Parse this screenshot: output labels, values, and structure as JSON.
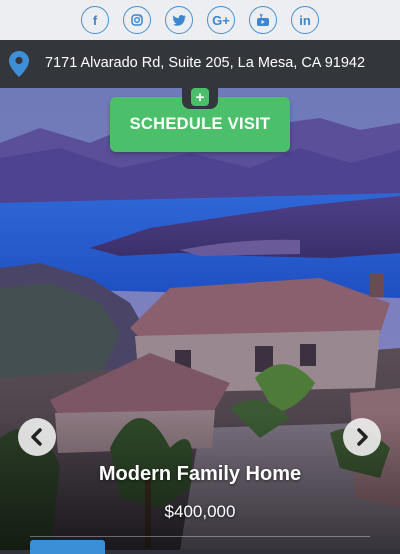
{
  "social": {
    "items": [
      {
        "name": "facebook-icon",
        "glyph": "f"
      },
      {
        "name": "instagram-icon",
        "glyph": ""
      },
      {
        "name": "twitter-icon",
        "glyph": ""
      },
      {
        "name": "google-plus-icon",
        "glyph": "G+"
      },
      {
        "name": "youtube-icon",
        "glyph": ""
      },
      {
        "name": "linkedin-icon",
        "glyph": "in"
      }
    ],
    "color": "#3b86cf"
  },
  "address": {
    "text": "7171 Alvarado Rd, Suite 205, La Mesa, CA 91942",
    "icon": "map-pin-icon"
  },
  "schedule": {
    "plus": "+",
    "label": "SCHEDULE VISIT",
    "color": "#4cbf6b"
  },
  "listing": {
    "title": "Modern Family Home",
    "price": "$400,000"
  },
  "carousel": {
    "prev_icon": "chevron-left-icon",
    "next_icon": "chevron-right-icon"
  }
}
